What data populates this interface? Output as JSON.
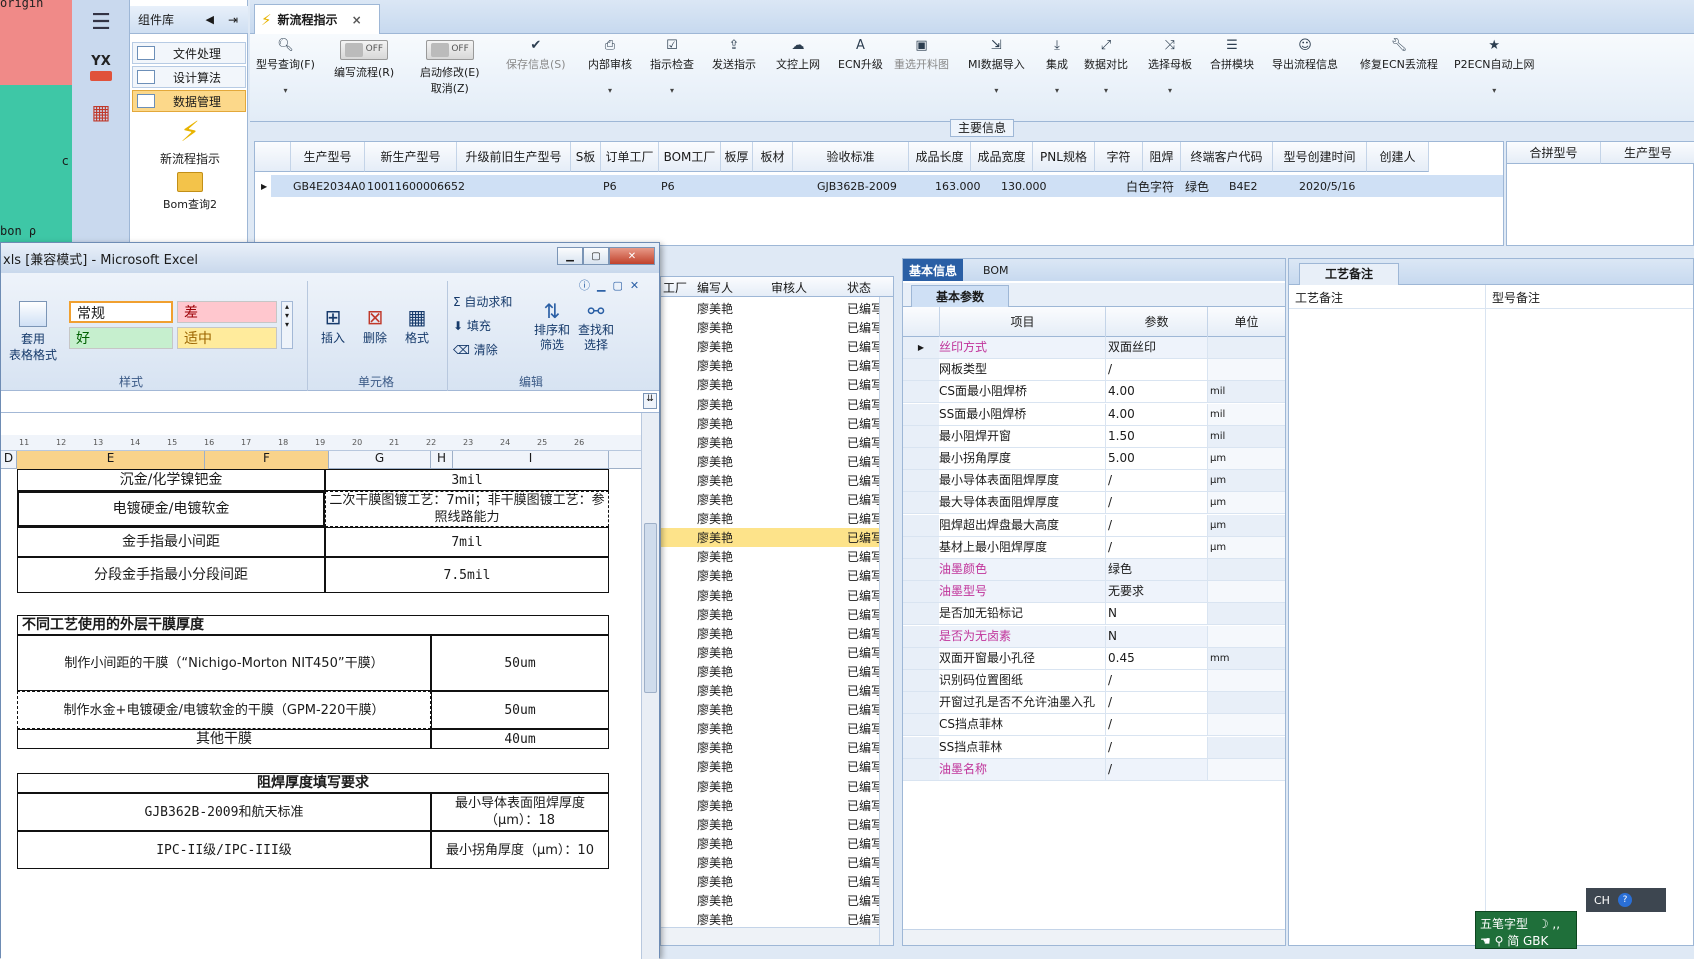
{
  "background": {
    "orig_text": "origin",
    "side_text": "bon    ρ",
    "side_c": "c"
  },
  "rail": {
    "menu_icon": "hamburger-icon",
    "yx_label": "YX",
    "calc_icon": "calculator-icon"
  },
  "component_panel": {
    "title": "组件库",
    "items": [
      {
        "label": "文件处理"
      },
      {
        "label": "设计算法"
      },
      {
        "label": "数据管理"
      }
    ],
    "new_flow_label": "新流程指示",
    "bom_query_label": "Bom查询2"
  },
  "main_tab": {
    "title": "新流程指示",
    "close": "×"
  },
  "ribbon": {
    "model_query": "型号查询(F)",
    "edit_flow": "编写流程(R)",
    "start_modify": "启动修改(E)",
    "cancel": "取消(Z)",
    "toggle_text": "OFF",
    "save_info": "保存信息(S)",
    "internal_review": "内部审核",
    "check_instruction": "指示检查",
    "send_instruction": "发送指示",
    "doc_upload": "文控上网",
    "ecn_upgrade": "ECN升级",
    "reselect_chart": "重选开料图",
    "mi_import": "MI数据导入",
    "integrate": "集成",
    "data_compare": "数据对比",
    "select_mother": "选择母板",
    "merge_module": "合拼模块",
    "export_flow": "导出流程信息",
    "modify_ecn": "修复ECN丢流程",
    "p2ecn": "P2ECN自动上网"
  },
  "main_info": {
    "label": "主要信息",
    "columns": [
      "生产型号",
      "新生产型号",
      "升级前旧生产型号",
      "S板",
      "订单工厂",
      "BOM工厂",
      "板厚",
      "板材",
      "验收标准",
      "成品长度",
      "成品宽度",
      "PNL规格",
      "字符",
      "阻焊",
      "终端客户代码",
      "型号创建时间",
      "创建人"
    ],
    "row": {
      "pn": "GB4E2034A0",
      "new_pn": "10011600006652",
      "order_factory": "P6",
      "bom_factory": "P6",
      "standard": "GJB362B-2009",
      "length": "163.000",
      "width": "130.000",
      "char": "白色字符",
      "solder": "绿色",
      "customer": "B4E2",
      "created": "2020/5/16"
    },
    "side_columns": [
      "合拼型号",
      "生产型号"
    ]
  },
  "list": {
    "columns": [
      "工厂",
      "编写人",
      "审核人",
      "状态"
    ],
    "writer": "廖美艳",
    "status": "已编写",
    "rows": 33
  },
  "props": {
    "tab_basic": "基本信息",
    "tab_bom": "BOM",
    "subtab": "基本参数",
    "headers": {
      "item": "项目",
      "param": "参数",
      "unit": "单位"
    },
    "rows": [
      {
        "k": "丝印方式",
        "v": "双面丝印",
        "u": "",
        "pink": true
      },
      {
        "k": "网板类型",
        "v": "/",
        "u": ""
      },
      {
        "k": "CS面最小阻焊桥",
        "v": "4.00",
        "u": "mil"
      },
      {
        "k": "SS面最小阻焊桥",
        "v": "4.00",
        "u": "mil"
      },
      {
        "k": "最小阻焊开窗",
        "v": "1.50",
        "u": "mil"
      },
      {
        "k": "最小拐角厚度",
        "v": "5.00",
        "u": "μm"
      },
      {
        "k": "最小导体表面阻焊厚度",
        "v": "/",
        "u": "μm"
      },
      {
        "k": "最大导体表面阻焊厚度",
        "v": "/",
        "u": "μm"
      },
      {
        "k": "阻焊超出焊盘最大高度",
        "v": "/",
        "u": "μm"
      },
      {
        "k": "基材上最小阻焊厚度",
        "v": "/",
        "u": "μm"
      },
      {
        "k": "油墨颜色",
        "v": "绿色",
        "u": "",
        "pink": true
      },
      {
        "k": "油墨型号",
        "v": "无要求",
        "u": "",
        "pink": true
      },
      {
        "k": "是否加无铅标记",
        "v": "N",
        "u": ""
      },
      {
        "k": "是否为无卤素",
        "v": "N",
        "u": "",
        "pink": true
      },
      {
        "k": "双面开窗最小孔径",
        "v": "0.45",
        "u": "mm"
      },
      {
        "k": "识别码位置图纸",
        "v": "/",
        "u": ""
      },
      {
        "k": "开窗过孔是否不允许油墨入孔",
        "v": "/",
        "u": ""
      },
      {
        "k": "CS挡点菲林",
        "v": "/",
        "u": ""
      },
      {
        "k": "SS挡点菲林",
        "v": "/",
        "u": ""
      },
      {
        "k": "油墨名称",
        "v": "/",
        "u": "",
        "pink": true
      }
    ]
  },
  "remark": {
    "tab": "工艺备注",
    "col1": "工艺备注",
    "col2": "型号备注"
  },
  "excel": {
    "title": "xls  [兼容模式] - Microsoft Excel",
    "styles": {
      "normal": "常规",
      "bad": "差",
      "good": "好",
      "neutral": "适中"
    },
    "table_format": "套用\n表格格式",
    "group_style": "样式",
    "group_cells": "单元格",
    "group_edit": "编辑",
    "insert": "插入",
    "delete": "删除",
    "format": "格式",
    "autosum": "自动求和",
    "fill": "填充",
    "clear": "清除",
    "sort": "排序和\n筛选",
    "find": "查找和\n选择",
    "ruler": [
      "11",
      "12",
      "13",
      "14",
      "15",
      "16",
      "17",
      "18",
      "19",
      "20",
      "21",
      "22",
      "23",
      "24",
      "25",
      "26"
    ],
    "col_headers": [
      "D",
      "E",
      "F",
      "G",
      "H",
      "I"
    ],
    "cells": {
      "r1a": "沉金/化学镍钯金",
      "r1b": "3mil",
      "r2a": "电镀硬金/电镀软金",
      "r2b": "二次干膜图镀工艺：7mil；非干膜图镀工艺：参照线路能力",
      "r3a": "金手指最小间距",
      "r3b": "7mil",
      "r4a": "分段金手指最小分段间距",
      "r4b": "7.5mil",
      "sec1": "不同工艺使用的外层干膜厚度",
      "d1a": "制作小间距的干膜（“Nichigo-Morton NIT450”干膜）",
      "d1b": "50um",
      "d2a": "制作水金+电镀硬金/电镀软金的干膜（GPM-220干膜）",
      "d2b": "50um",
      "d3a": "其他干膜",
      "d3b": "40um",
      "sec2": "阻焊厚度填写要求",
      "s1a": "GJB362B-2009和航天标准",
      "s1b": "最小导体表面阻焊厚度（μm）：18",
      "s2a": "IPC-II级/IPC-III级",
      "s2b": "最小拐角厚度（μm）：10"
    }
  },
  "ime": {
    "line1": "五笔字型",
    "line2": "简 GBK",
    "lang": "CH"
  }
}
